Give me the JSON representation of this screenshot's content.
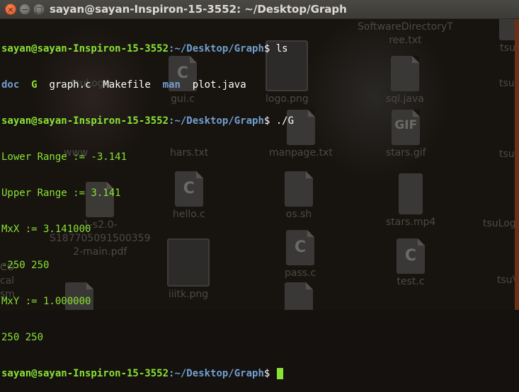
{
  "window": {
    "title": "sayan@sayan-Inspiron-15-3552: ~/Desktop/Graph",
    "close_glyph": "×",
    "minimize_glyph": "−",
    "maximize_glyph": "□"
  },
  "terminal": {
    "user_host": "sayan@sayan-Inspiron-15-3552",
    "path": ":~/Desktop/Graph",
    "prompt_symbol": "$",
    "cmd1": " ls",
    "ls_items": [
      {
        "name": "doc",
        "kind": "dir"
      },
      {
        "name": "G",
        "kind": "exe"
      },
      {
        "name": "graph.c",
        "kind": "file"
      },
      {
        "name": "Makefile",
        "kind": "file"
      },
      {
        "name": "man",
        "kind": "dir"
      },
      {
        "name": "plot.java",
        "kind": "file"
      }
    ],
    "cmd2": " ./G",
    "output": [
      "Lower Range := -3.141",
      "Upper Range := 3.141",
      "MxX := 3.141000",
      "-250 250",
      "MxY := 1.000000",
      "250 250"
    ],
    "cmd3": " "
  },
  "desktop_icons": [
    {
      "label": "SoftwareDirectoryT",
      "label2": "ree.txt",
      "glyph": ""
    },
    {
      "label": "tsu",
      "glyph": ""
    },
    {
      "label": "gui.c",
      "glyph": "C"
    },
    {
      "label": "logo.png",
      "glyph": ""
    },
    {
      "label": "sql.java",
      "glyph": ""
    },
    {
      "label": "tsuLogo",
      "glyph": ""
    },
    {
      "label": "tsu",
      "glyph": ""
    },
    {
      "label": "www",
      "glyph": ""
    },
    {
      "label": "hars.txt",
      "glyph": ""
    },
    {
      "label": "manpage.txt",
      "glyph": ""
    },
    {
      "label": "stars.gif",
      "glyph": "GIF"
    },
    {
      "label": "tsu",
      "glyph": ""
    },
    {
      "label": "hello.c",
      "glyph": "C"
    },
    {
      "label": "os.sh",
      "glyph": ""
    },
    {
      "label": "stars.mp4",
      "glyph": ""
    },
    {
      "label": "1-s2.0-",
      "label2": "S187705091500359",
      "label3": "2-main.pdf",
      "glyph": ""
    },
    {
      "label": "tsuLog",
      "glyph": ""
    },
    {
      "label": "CO",
      "label2": "cal",
      "label3": "sm",
      "glyph": ""
    },
    {
      "label": "iiitk.png",
      "glyph": ""
    },
    {
      "label": "pass.c",
      "glyph": "C"
    },
    {
      "label": "test.c",
      "glyph": "C"
    },
    {
      "label": "tsuV",
      "glyph": ""
    }
  ],
  "colors": {
    "user_host": "#8ae234",
    "path": "#729fcf",
    "cursor": "#8ae234",
    "close_button": "#e5541f"
  }
}
